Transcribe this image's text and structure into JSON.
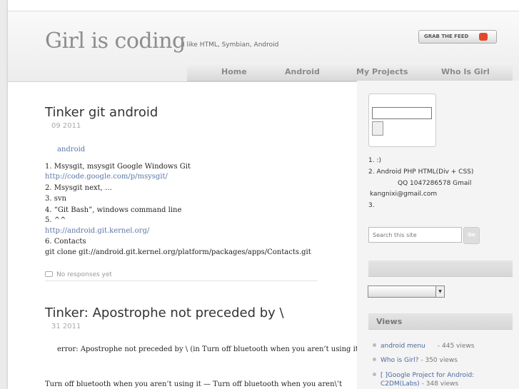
{
  "header": {
    "site_title": "Girl is coding",
    "tagline": "I like HTML, Symbian, Android",
    "feed_label": "GRAB THE FEED"
  },
  "nav": [
    "Home",
    "Android",
    "My Projects",
    "Who Is Girl"
  ],
  "posts": [
    {
      "title": "Tinker   git   android",
      "date": "09 2011",
      "category": "android",
      "lines": {
        "l1": "1.      Msysgit, msysgit  Google  Windows            Git",
        "l1_link": "http://code.google.com/p/msysgit/",
        "l2": "2.      Msysgit          next,          …",
        "l3": "3.                                                       svn",
        "l4": "4.                            “Git Bash”,            windows command line",
        "l5": "5.                                                        ^^",
        "l5_link": "http://android.git.kernel.org/",
        "l6": "6.                          Contacts",
        "l7": "git clone git://android.git.kernel.org/platform/packages/apps/Contacts.git"
      },
      "comments": "No responses yet"
    },
    {
      "title": "Tinker: Apostrophe not preceded by \\",
      "date": "31 2011",
      "body1": "error: Apostrophe not preceded by \\ (in Turn off bluetooth when you aren’t using it)",
      "body2": "Turn off bluetooth when you aren’t using it —   Turn off bluetooth when you aren\\’t"
    }
  ],
  "sidebar": {
    "about": {
      "l1": "1.                             :)",
      "l2": "2.    Android PHP HTML(Div + CSS)",
      "l3": "QQ 1047286578 Gmail",
      "l4": "kangnixi@gmail.com",
      "l5": "3."
    },
    "search_placeholder": "Search this site",
    "search_go": "Go",
    "views_title": "Views",
    "views": [
      {
        "title": "android   menu",
        "count": "- 445 views"
      },
      {
        "title": "Who is Girl?",
        "count": "- 350 views"
      },
      {
        "title": "[  ]Google Project for Android:",
        "title2": "C2DM(Labs)",
        "count": "- 348 views"
      }
    ]
  }
}
